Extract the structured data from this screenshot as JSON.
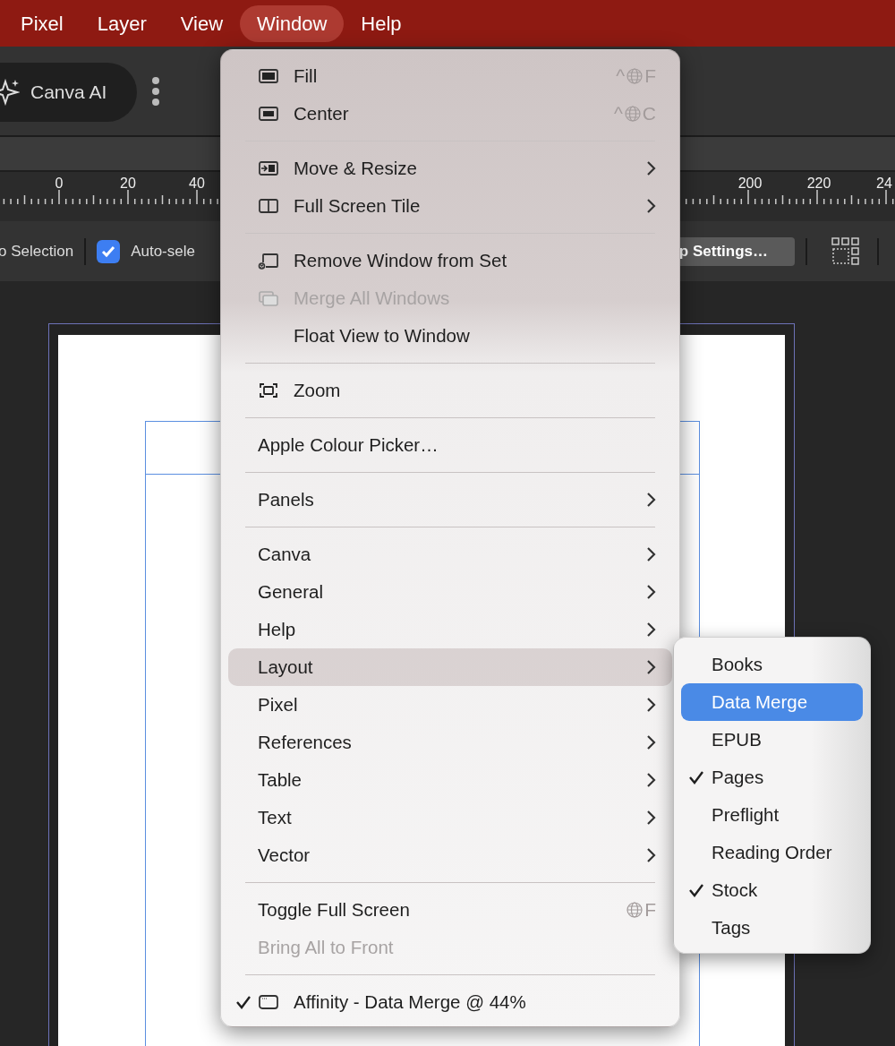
{
  "menubar": {
    "items": [
      {
        "label": "Pixel",
        "selected": false
      },
      {
        "label": "Layer",
        "selected": false
      },
      {
        "label": "View",
        "selected": false
      },
      {
        "label": "Window",
        "selected": true
      },
      {
        "label": "Help",
        "selected": false
      }
    ]
  },
  "toolbar": {
    "ai_button": "Canva AI"
  },
  "ruler": {
    "labels": [
      "0",
      "20",
      "40",
      "200",
      "220",
      "24"
    ]
  },
  "context_bar": {
    "selection_label": "o Selection",
    "auto_select": {
      "label": "Auto-sele",
      "checked": true
    },
    "settings_button": "p Settings…"
  },
  "window_menu": {
    "groups": [
      [
        {
          "label": "Fill",
          "kind": "fill",
          "shortcut": {
            "prefix": "^",
            "globe": true,
            "key": "F"
          },
          "submenu": false,
          "disabled": false,
          "checked": false,
          "selected": false
        },
        {
          "label": "Center",
          "kind": "center",
          "shortcut": {
            "prefix": "^",
            "globe": true,
            "key": "C"
          },
          "submenu": false,
          "disabled": false,
          "checked": false,
          "selected": false
        }
      ],
      [
        {
          "label": "Move & Resize",
          "kind": "move",
          "submenu": true,
          "disabled": false,
          "checked": false,
          "selected": false
        },
        {
          "label": "Full Screen Tile",
          "kind": "tile",
          "submenu": true,
          "disabled": false,
          "checked": false,
          "selected": false
        }
      ],
      [
        {
          "label": "Remove Window from Set",
          "kind": "remove",
          "submenu": false,
          "disabled": false,
          "checked": false,
          "selected": false
        },
        {
          "label": "Merge All Windows",
          "kind": "merge",
          "submenu": false,
          "disabled": true,
          "checked": false,
          "selected": false
        },
        {
          "label": "Float View to Window",
          "submenu": false,
          "disabled": false,
          "checked": false,
          "selected": false
        }
      ],
      [
        {
          "label": "Zoom",
          "kind": "zoom",
          "submenu": false,
          "disabled": false,
          "checked": false,
          "selected": false
        }
      ],
      [
        {
          "label": "Apple Colour Picker…",
          "submenu": false,
          "disabled": false,
          "checked": false,
          "selected": false
        }
      ],
      [
        {
          "label": "Panels",
          "submenu": true,
          "disabled": false,
          "checked": false,
          "selected": false
        }
      ],
      [
        {
          "label": "Canva",
          "submenu": true,
          "disabled": false,
          "checked": false,
          "selected": false
        },
        {
          "label": "General",
          "submenu": true,
          "disabled": false,
          "checked": false,
          "selected": false
        },
        {
          "label": "Help",
          "submenu": true,
          "disabled": false,
          "checked": false,
          "selected": false
        },
        {
          "label": "Layout",
          "submenu": true,
          "disabled": false,
          "checked": false,
          "selected": true
        },
        {
          "label": "Pixel",
          "submenu": true,
          "disabled": false,
          "checked": false,
          "selected": false
        },
        {
          "label": "References",
          "submenu": true,
          "disabled": false,
          "checked": false,
          "selected": false
        },
        {
          "label": "Table",
          "submenu": true,
          "disabled": false,
          "checked": false,
          "selected": false
        },
        {
          "label": "Text",
          "submenu": true,
          "disabled": false,
          "checked": false,
          "selected": false
        },
        {
          "label": "Vector",
          "submenu": true,
          "disabled": false,
          "checked": false,
          "selected": false
        }
      ],
      [
        {
          "label": "Toggle Full Screen",
          "shortcut": {
            "globe": true,
            "key": "F"
          },
          "submenu": false,
          "disabled": false,
          "checked": false,
          "selected": false
        },
        {
          "label": "Bring All to Front",
          "submenu": false,
          "disabled": true,
          "checked": false,
          "selected": false
        }
      ],
      [
        {
          "label": "Affinity - Data Merge @ 44%",
          "kind": "window",
          "submenu": false,
          "disabled": false,
          "checked": true,
          "selected": false
        }
      ]
    ]
  },
  "layout_submenu": {
    "items": [
      {
        "label": "Books",
        "checked": false,
        "selected": false
      },
      {
        "label": "Data Merge",
        "checked": false,
        "selected": true
      },
      {
        "label": "EPUB",
        "checked": false,
        "selected": false
      },
      {
        "label": "Pages",
        "checked": true,
        "selected": false
      },
      {
        "label": "Preflight",
        "checked": false,
        "selected": false
      },
      {
        "label": "Reading Order",
        "checked": false,
        "selected": false
      },
      {
        "label": "Stock",
        "checked": true,
        "selected": false
      },
      {
        "label": "Tags",
        "checked": false,
        "selected": false
      }
    ]
  }
}
